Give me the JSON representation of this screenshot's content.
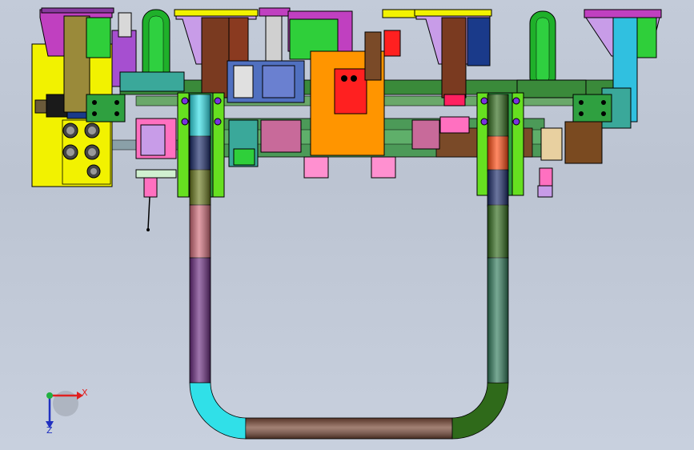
{
  "viewport": {
    "background_top": "#c3cbd9",
    "background_bottom": "#c8d0de"
  },
  "triad": {
    "x_label": "X",
    "y_label": "Z",
    "x_color": "#e02020",
    "y_color": "#2030c0",
    "origin_color": "#20b040"
  },
  "colors": {
    "yellow": "#f2f200",
    "green": "#2fcf3a",
    "magenta": "#c040c0",
    "violet": "#a64fd0",
    "orange": "#ff9500",
    "red": "#ff2020",
    "cyan": "#30e0e8",
    "brown": "#7a3a20",
    "teal": "#3aa89a",
    "olive": "#6b7a1e",
    "pink": "#ff70c0",
    "navy": "#1a2a6a",
    "purple": "#6a2a80",
    "dark_green": "#2f6a1a",
    "lavender": "#c89ce8"
  }
}
